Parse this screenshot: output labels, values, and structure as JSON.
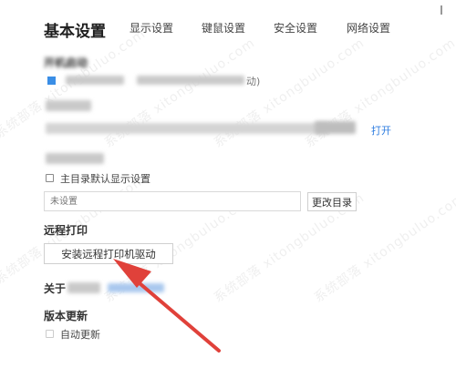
{
  "header": {
    "title": "基本设置",
    "tabs": [
      "显示设置",
      "键鼠设置",
      "安全设置",
      "网络设置"
    ]
  },
  "sections": {
    "startup_label": "开机启动",
    "startup_option_tail": "动)",
    "open_link": "打开",
    "main_dir_checkbox_label": "主目录默认显示设置",
    "dir_placeholder": "未设置",
    "change_dir_button": "更改目录",
    "remote_print_label": "远程打印",
    "install_driver_button": "安装远程打印机驱动",
    "about_label": "关于",
    "version_update_label": "版本更新",
    "auto_update_label": "自动更新"
  },
  "watermark": "系统部落 xitongbuluo.com",
  "colors": {
    "accent": "#2f7ee0",
    "arrow": "#e0413a"
  }
}
